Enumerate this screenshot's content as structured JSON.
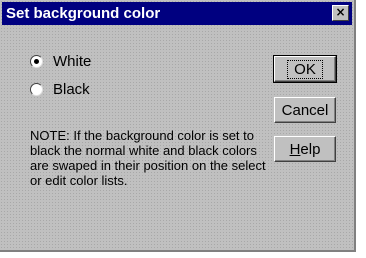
{
  "dialog": {
    "title": "Set background color",
    "close_glyph": "×"
  },
  "options": [
    {
      "label": "White",
      "checked": true
    },
    {
      "label": "Black",
      "checked": false
    }
  ],
  "note": "NOTE: If the background color is set to black the normal white and black colors are swaped in their position on the select or edit color lists.",
  "buttons": {
    "ok": "OK",
    "cancel": "Cancel",
    "help_mnemonic": "H",
    "help_rest": "elp"
  }
}
